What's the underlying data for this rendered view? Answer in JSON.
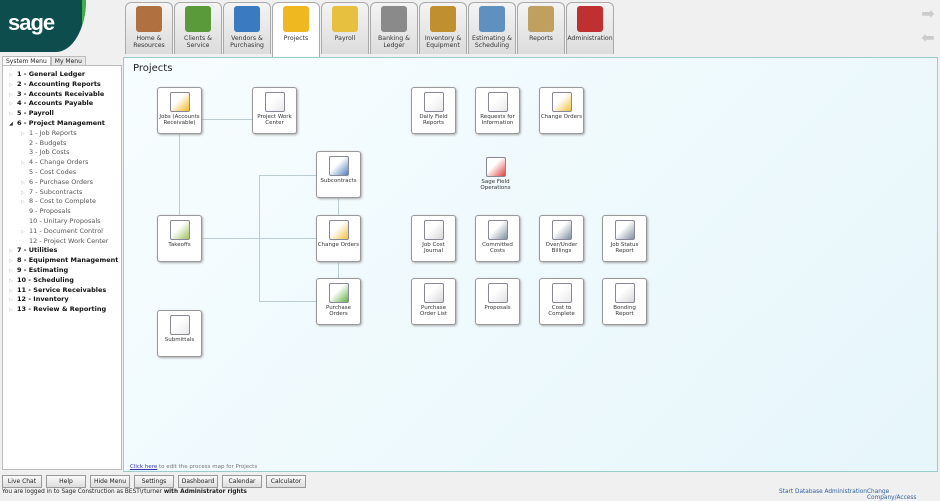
{
  "logo": "sage",
  "tabs": [
    {
      "label": "Home &\nResources",
      "color": "#b07040"
    },
    {
      "label": "Clients &\nService",
      "color": "#5a9a3a"
    },
    {
      "label": "Vendors &\nPurchasing",
      "color": "#3a7ac0"
    },
    {
      "label": "Projects",
      "color": "#f0b820",
      "active": true
    },
    {
      "label": "Payroll",
      "color": "#e8c040"
    },
    {
      "label": "Banking &\nLedger",
      "color": "#8a8a8a"
    },
    {
      "label": "Inventory &\nEquipment",
      "color": "#c09030"
    },
    {
      "label": "Estimating &\nScheduling",
      "color": "#6090c0"
    },
    {
      "label": "Reports",
      "color": "#c0a060"
    },
    {
      "label": "Administration",
      "color": "#c03030"
    }
  ],
  "menu_tabs": [
    "System Menu",
    "My Menu"
  ],
  "menu": [
    {
      "label": "1 - General Ledger",
      "level": 0
    },
    {
      "label": "2 - Accounting Reports",
      "level": 0
    },
    {
      "label": "3 - Accounts Receivable",
      "level": 0
    },
    {
      "label": "4 - Accounts Payable",
      "level": 0
    },
    {
      "label": "5 - Payroll",
      "level": 0
    },
    {
      "label": "6 - Project Management",
      "level": 0,
      "open": true
    },
    {
      "label": "1 - Job Reports",
      "level": 1,
      "arrow": true
    },
    {
      "label": "2 - Budgets",
      "level": 1
    },
    {
      "label": "3 - Job Costs",
      "level": 1
    },
    {
      "label": "4 - Change Orders",
      "level": 1,
      "arrow": true
    },
    {
      "label": "5 - Cost Codes",
      "level": 1
    },
    {
      "label": "6 - Purchase Orders",
      "level": 1,
      "arrow": true
    },
    {
      "label": "7 - Subcontracts",
      "level": 1,
      "arrow": true
    },
    {
      "label": "8 - Cost to Complete",
      "level": 1,
      "arrow": true
    },
    {
      "label": "9 - Proposals",
      "level": 1
    },
    {
      "label": "10 - Unitary Proposals",
      "level": 1
    },
    {
      "label": "11 - Document Control",
      "level": 1,
      "arrow": true
    },
    {
      "label": "12 - Project Work Center",
      "level": 1
    },
    {
      "label": "7 - Utilities",
      "level": 0
    },
    {
      "label": "8 - Equipment Management",
      "level": 0
    },
    {
      "label": "9 - Estimating",
      "level": 0
    },
    {
      "label": "10 - Scheduling",
      "level": 0
    },
    {
      "label": "11 - Service Receivables",
      "level": 0
    },
    {
      "label": "12 - Inventory",
      "level": 0
    },
    {
      "label": "13 - Review & Reporting",
      "level": 0
    }
  ],
  "page_title": "Projects",
  "nodes": [
    {
      "label": "Jobs (Accounts\nReceivable)",
      "icon": "hardhat-icon",
      "color": "#f0b820"
    },
    {
      "label": "Project Work\nCenter",
      "icon": "document-pencil-icon",
      "color": "#e8e8e8"
    },
    {
      "label": "Daily Field\nReports",
      "icon": "document-pencil-icon",
      "color": "#e8e8e8"
    },
    {
      "label": "Requests for\nInformation",
      "icon": "document-pencil-icon",
      "color": "#e8e8e8"
    },
    {
      "label": "Change Orders",
      "icon": "document-warning-icon",
      "color": "#f0c040"
    },
    {
      "label": "Subcontracts",
      "icon": "person-document-icon",
      "color": "#5080c0"
    },
    {
      "label": "Sage Field\nOperations",
      "icon": "sage-field-operations-icon",
      "color": "#e04040"
    },
    {
      "label": "Takeoffs",
      "icon": "calculator-icon",
      "color": "#a0c060"
    },
    {
      "label": "Change Orders",
      "icon": "document-warning-icon",
      "color": "#f0c040"
    },
    {
      "label": "Job Cost\nJournal",
      "icon": "report-icon",
      "color": "#d8d8d8"
    },
    {
      "label": "Committed\nCosts",
      "icon": "printer-icon",
      "color": "#8090a0"
    },
    {
      "label": "Over/Under\nBillings",
      "icon": "printer-icon",
      "color": "#8090a0"
    },
    {
      "label": "Job Status\nReport",
      "icon": "printer-icon",
      "color": "#8090a0"
    },
    {
      "label": "Purchase\nOrders",
      "icon": "document-cart-icon",
      "color": "#60b040"
    },
    {
      "label": "Purchase\nOrder List",
      "icon": "report-icon",
      "color": "#d8d8d8"
    },
    {
      "label": "Proposals",
      "icon": "document-icon",
      "color": "#e0e0e0"
    },
    {
      "label": "Cost to\nComplete",
      "icon": "document-pencil-icon",
      "color": "#e8e8e8"
    },
    {
      "label": "Bonding\nReport",
      "icon": "report-icon",
      "color": "#d8d8d8"
    },
    {
      "label": "Submittals",
      "icon": "document-pencil-icon",
      "color": "#e8e8e8"
    }
  ],
  "edit_link": {
    "link": "Click here",
    "rest": " to edit the process map for Projects"
  },
  "buttons": [
    "Live Chat",
    "Help",
    "Hide Menu",
    "Settings",
    "Dashboard",
    "Calendar",
    "Calculator"
  ],
  "status": {
    "prefix": "You are logged in to Sage Construction as BEST\\rturner ",
    "rights": "with Administrator rights"
  },
  "links": [
    "Start Database Administration",
    "Change Company/Access"
  ]
}
